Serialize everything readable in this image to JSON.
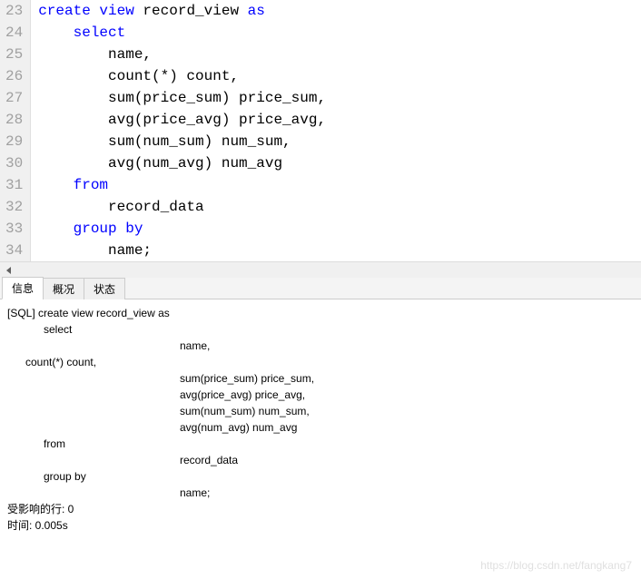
{
  "gutter": [
    "23",
    "24",
    "25",
    "26",
    "27",
    "28",
    "29",
    "30",
    "31",
    "32",
    "33",
    "34"
  ],
  "code": {
    "l23": {
      "pre": "",
      "kw": "create view",
      "post": " record_view ",
      "kw2": "as"
    },
    "l24": {
      "pre": "    ",
      "kw": "select"
    },
    "l25": {
      "pre": "        ",
      "txt": "name,"
    },
    "l26": {
      "pre": "        ",
      "txt": "count(*) count,"
    },
    "l27": {
      "pre": "        ",
      "txt": "sum(price_sum) price_sum,"
    },
    "l28": {
      "pre": "        ",
      "txt": "avg(price_avg) price_avg,"
    },
    "l29": {
      "pre": "        ",
      "txt": "sum(num_sum) num_sum,"
    },
    "l30": {
      "pre": "        ",
      "txt": "avg(num_avg) num_avg"
    },
    "l31": {
      "pre": "    ",
      "kw": "from"
    },
    "l32": {
      "pre": "        ",
      "txt": "record_data"
    },
    "l33": {
      "pre": "    ",
      "kw": "group by"
    },
    "l34": {
      "pre": "        ",
      "txt": "name;"
    }
  },
  "tabs": {
    "info": "信息",
    "overview": "概况",
    "status": "状态"
  },
  "output": {
    "line1": "[SQL] create view record_view as",
    "line2": "            select",
    "line3_col2": "name,",
    "line4": "      count(*) count,",
    "line5_col2": "sum(price_sum) price_sum,",
    "line6_col2": "avg(price_avg) price_avg,",
    "line7_col2": "sum(num_sum) num_sum,",
    "line8_col2": "avg(num_avg) num_avg",
    "line9": "            from",
    "line10_col2": "record_data",
    "line11": "            group by",
    "line12_col2": "name;",
    "affected": "受影响的行: 0",
    "time": "时间: 0.005s"
  },
  "watermark": "https://blog.csdn.net/fangkang7"
}
